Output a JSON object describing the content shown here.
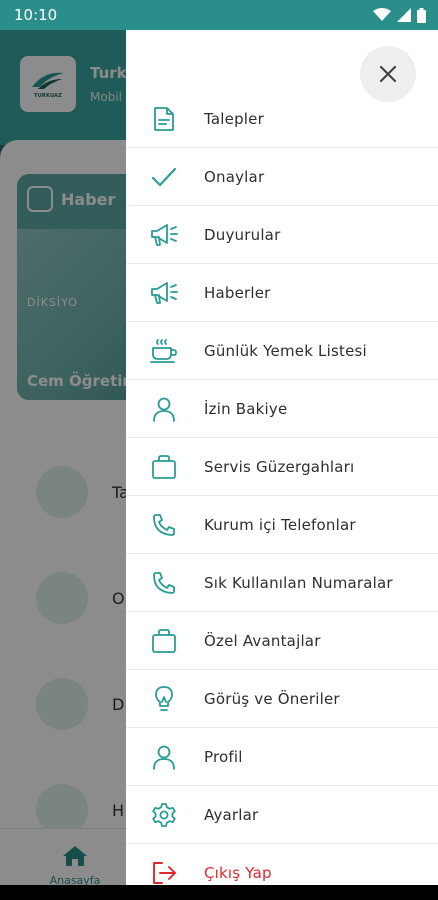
{
  "status_bar": {
    "time": "10:10"
  },
  "background": {
    "brand": "Turk",
    "brand_sub": "Mobil",
    "logo_text": "TURKUAZ",
    "news_card": {
      "tag": "Haber",
      "overlay_text": "DİKSİYO",
      "title": "Cem Öğretim Eğitimi"
    },
    "rows": [
      {
        "label": "Ta"
      },
      {
        "label": "O"
      },
      {
        "label": "D"
      },
      {
        "label": "H"
      }
    ],
    "bottom_nav": {
      "home_label": "Anasayfa"
    }
  },
  "drawer": {
    "close_icon": "close-icon",
    "items": [
      {
        "label": "Talepler",
        "icon": "document-icon"
      },
      {
        "label": "Onaylar",
        "icon": "check-icon"
      },
      {
        "label": "Duyurular",
        "icon": "megaphone-icon"
      },
      {
        "label": "Haberler",
        "icon": "megaphone-icon"
      },
      {
        "label": "Günlük Yemek Listesi",
        "icon": "cup-icon"
      },
      {
        "label": "İzin Bakiye",
        "icon": "person-icon"
      },
      {
        "label": "Servis Güzergahları",
        "icon": "bag-icon"
      },
      {
        "label": "Kurum içi Telefonlar",
        "icon": "phone-icon"
      },
      {
        "label": "Sık Kullanılan Numaralar",
        "icon": "phone-icon"
      },
      {
        "label": "Özel Avantajlar",
        "icon": "bag-icon"
      },
      {
        "label": "Görüş ve Öneriler",
        "icon": "lightbulb-icon"
      },
      {
        "label": "Profil",
        "icon": "person-icon"
      },
      {
        "label": "Ayarlar",
        "icon": "gear-icon"
      },
      {
        "label": "Çıkış Yap",
        "icon": "logout-icon"
      }
    ]
  },
  "colors": {
    "teal": "#2a9c95",
    "logout_red": "#e0282b"
  }
}
